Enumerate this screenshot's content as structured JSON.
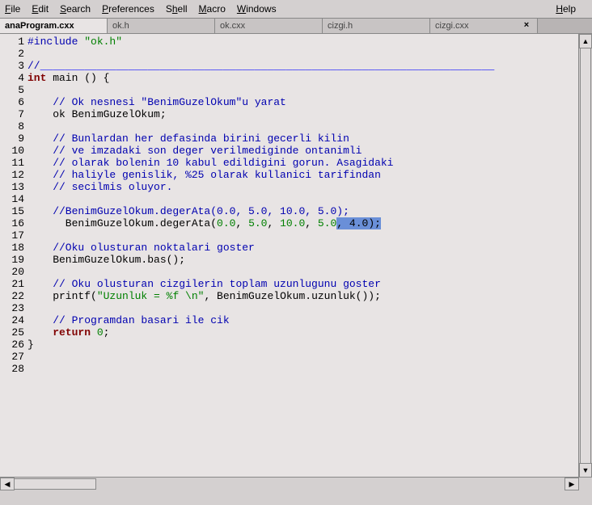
{
  "menubar": {
    "file": "File",
    "edit": "Edit",
    "search": "Search",
    "preferences": "Preferences",
    "shell": "Shell",
    "macro": "Macro",
    "windows": "Windows",
    "help": "Help"
  },
  "tabs": [
    {
      "label": "anaProgram.cxx",
      "active": true
    },
    {
      "label": "ok.h",
      "active": false
    },
    {
      "label": "ok.cxx",
      "active": false
    },
    {
      "label": "cizgi.h",
      "active": false
    },
    {
      "label": "cizgi.cxx",
      "active": false
    }
  ],
  "close_symbol": "×",
  "gutter": [
    "1",
    "2",
    "3",
    "4",
    "5",
    "6",
    "7",
    "8",
    "9",
    "10",
    "11",
    "12",
    "13",
    "14",
    "15",
    "16",
    "17",
    "18",
    "19",
    "20",
    "21",
    "22",
    "23",
    "24",
    "25",
    "26",
    "27",
    "28"
  ],
  "code": {
    "l1a": "#include ",
    "l1b": "\"ok.h\"",
    "l3a": "//",
    "l3b": "________________________________________________________________________",
    "l4a": "int",
    "l4b": " main () {",
    "l6": "    // Ok nesnesi \"BenimGuzelOkum\"u yarat",
    "l7": "    ok BenimGuzelOkum;",
    "l9": "    // Bunlardan her defasinda birini gecerli kilin",
    "l10": "    // ve imzadaki son deger verilmediginde ontanimli",
    "l11": "    // olarak bolenin 10 kabul edildigini gorun. Asagidaki",
    "l12": "    // haliyle genislik, %25 olarak kullanici tarifindan",
    "l13": "    // secilmis oluyor.",
    "l15": "    //BenimGuzelOkum.degerAta(0.0, 5.0, 10.0, 5.0);",
    "l16a": "      BenimGuzelOkum.degerAta(",
    "l16_n1": "0.0",
    "l16_c": ", ",
    "l16_n2": "5.0",
    "l16_n3": "10.0",
    "l16_n4": "5.0",
    "l16_sel": ", 4.0);",
    "l18": "    //Oku olusturan noktalari goster",
    "l19": "    BenimGuzelOkum.bas();",
    "l21": "    // Oku olusturan cizgilerin toplam uzunlugunu goster",
    "l22a": "    printf(",
    "l22b": "\"Uzunluk = %f \\n\"",
    "l22c": ", BenimGuzelOkum.uzunluk());",
    "l24": "    // Programdan basari ile cik",
    "l25a": "    ",
    "l25b": "return",
    "l25c": " ",
    "l25d": "0",
    "l25e": ";",
    "l26": "}"
  },
  "scroll_arrows": {
    "up": "▲",
    "down": "▼",
    "left": "◀",
    "right": "▶"
  }
}
